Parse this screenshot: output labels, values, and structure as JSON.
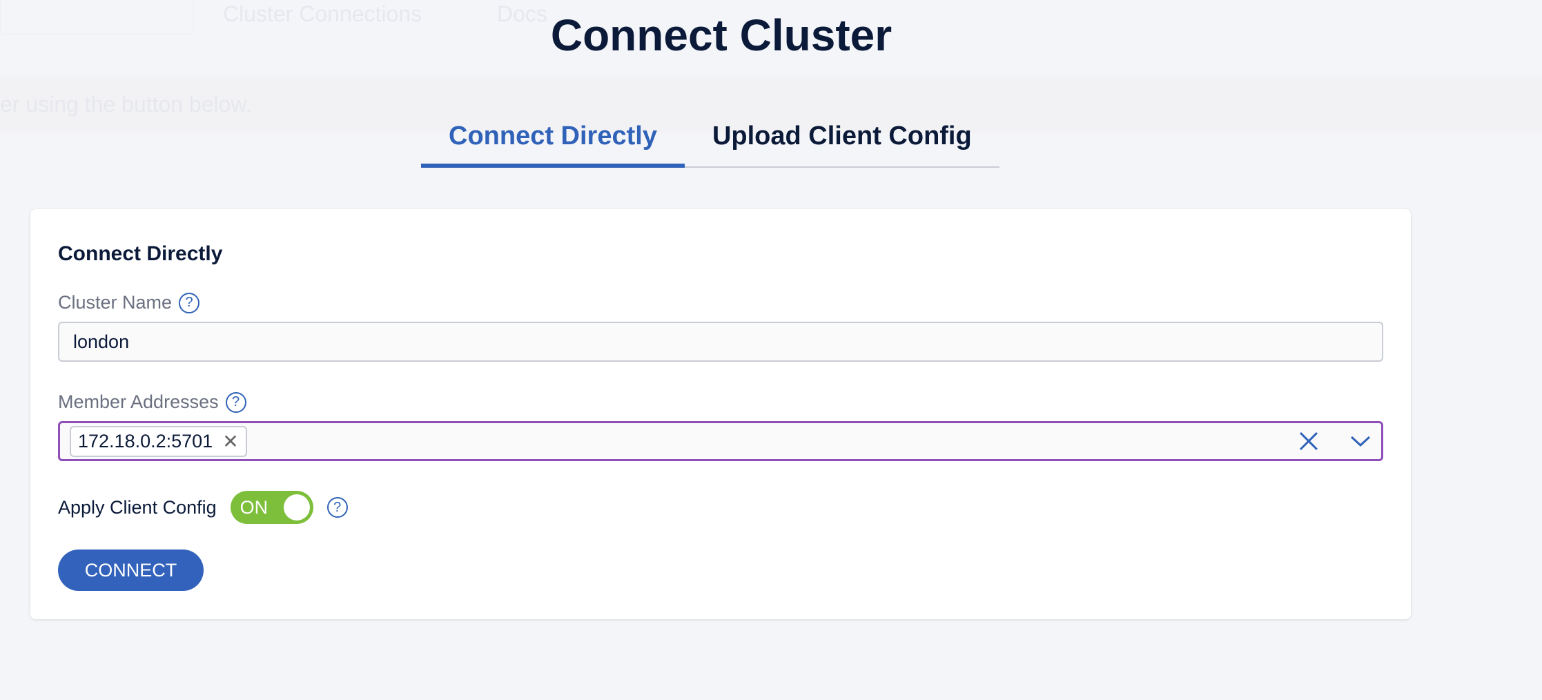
{
  "background": {
    "nav_cluster_connections": "Cluster Connections",
    "nav_docs": "Docs",
    "banner_text": "er using the button below."
  },
  "title": "Connect Cluster",
  "tabs": [
    {
      "label": "Connect Directly",
      "active": true
    },
    {
      "label": "Upload Client Config",
      "active": false
    }
  ],
  "form": {
    "heading": "Connect Directly",
    "cluster_name_label": "Cluster Name",
    "cluster_name_value": "london",
    "member_addresses_label": "Member Addresses",
    "member_addresses": [
      "172.18.0.2:5701"
    ],
    "apply_client_config_label": "Apply Client Config",
    "apply_client_config_state": "ON",
    "connect_label": "CONNECT"
  },
  "colors": {
    "accent": "#3262bb",
    "toggle_on": "#7dbf3b",
    "focus_border": "#8e4fb8"
  }
}
